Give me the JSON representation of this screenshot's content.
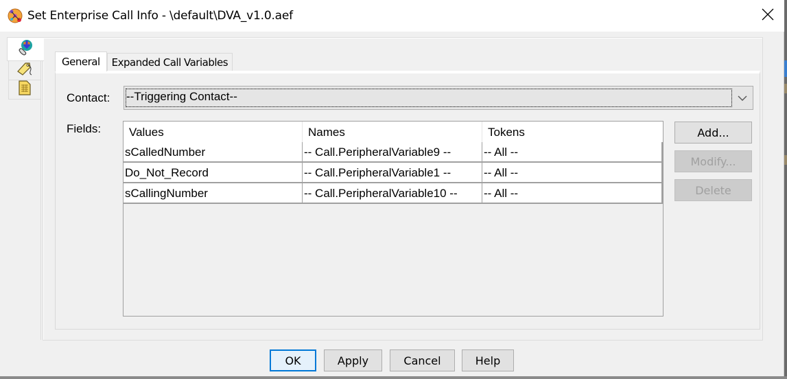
{
  "window": {
    "title": "Set Enterprise Call Info - \\default\\DVA_v1.0.aef",
    "app_icon": "script-editor-icon",
    "close_icon": "close-icon"
  },
  "side_tabs": [
    {
      "icon": "call-contact-icon",
      "active": true
    },
    {
      "icon": "tag-icon",
      "active": false
    },
    {
      "icon": "document-icon",
      "active": false
    }
  ],
  "tabs": [
    {
      "label": "General",
      "active": true
    },
    {
      "label": "Expanded Call Variables",
      "active": false
    }
  ],
  "form": {
    "contact_label": "Contact:",
    "contact_value": "--Triggering Contact--",
    "fields_label": "Fields:"
  },
  "table": {
    "columns": [
      "Values",
      "Names",
      "Tokens"
    ],
    "rows": [
      [
        "sCalledNumber",
        "-- Call.PeripheralVariable9 --",
        "-- All --"
      ],
      [
        "Do_Not_Record",
        "-- Call.PeripheralVariable1 --",
        "-- All --"
      ],
      [
        "sCallingNumber",
        "-- Call.PeripheralVariable10 --",
        "-- All --"
      ]
    ]
  },
  "side_buttons": {
    "add": "Add...",
    "modify": "Modify...",
    "delete": "Delete"
  },
  "footer": {
    "ok": "OK",
    "apply": "Apply",
    "cancel": "Cancel",
    "help": "Help"
  },
  "colors": {
    "accent": "#0078d7",
    "button_face": "#e1e1e1",
    "disabled_text": "#a0a0a0"
  }
}
